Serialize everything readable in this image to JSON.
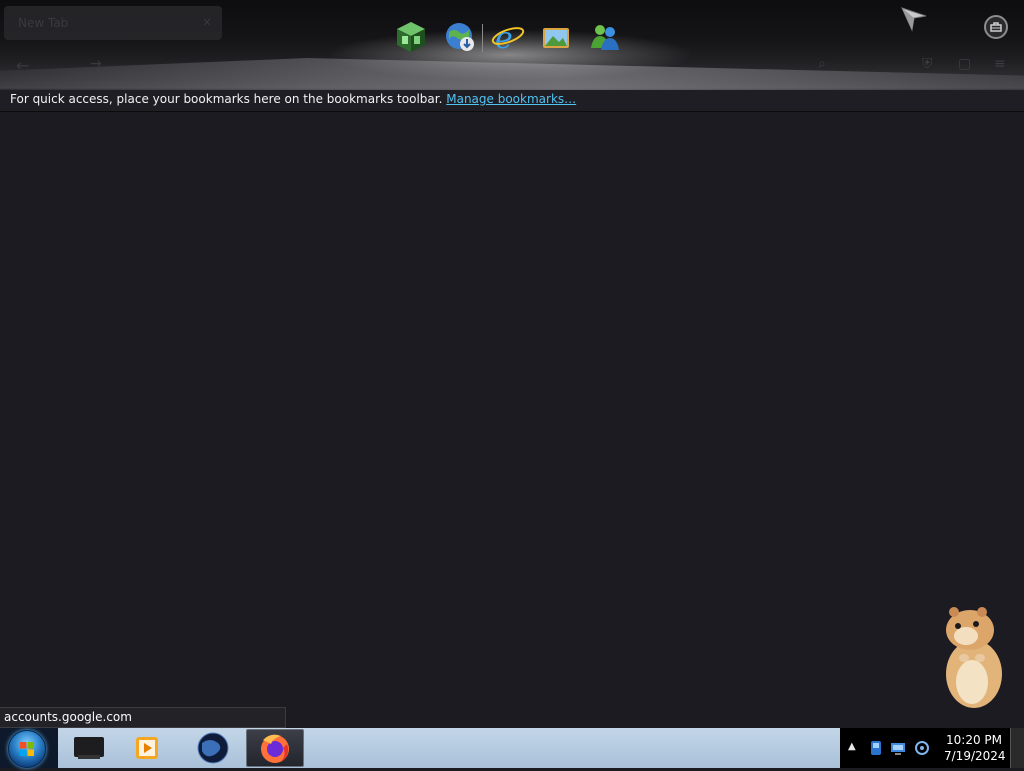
{
  "browser": {
    "tab": {
      "title": "New Tab",
      "close_glyph": "×"
    },
    "toolbar": {
      "back_glyph": "←",
      "forward_glyph": "→",
      "search_glyph": "⌕",
      "shield_glyph": "⛨",
      "extensions_glyph": "▢",
      "menu_glyph": "≡"
    },
    "bookmarks_bar": {
      "message": "For quick access, place your bookmarks here on the bookmarks toolbar.",
      "link_label": "Manage bookmarks…"
    },
    "status_url": "accounts.google.com"
  },
  "dock": {
    "icons": [
      "cube-app-icon",
      "globe-download-icon",
      "internet-explorer-icon",
      "photo-viewer-icon",
      "messenger-icon"
    ]
  },
  "overlay": {
    "send_icon": "paper-plane-icon",
    "toolbox_icon": "toolbox-icon",
    "mascot": "hamster-mascot-icon"
  },
  "taskbar": {
    "pinned": [
      "start-orb-icon",
      "media-center-icon",
      "media-player-icon",
      "globe-app-icon",
      "firefox-icon"
    ],
    "active_app": "firefox",
    "tray": {
      "arrow_glyph": "▲",
      "icons": [
        "app-tray-icon",
        "network-icon",
        "volume-icon"
      ]
    },
    "clock": {
      "time": "10:20 PM",
      "date": "7/19/2024"
    }
  },
  "colors": {
    "content_bg": "#1c1b22",
    "link": "#53c2f0",
    "taskbar": "#b6cbe0",
    "tray_bg": "#000000"
  }
}
